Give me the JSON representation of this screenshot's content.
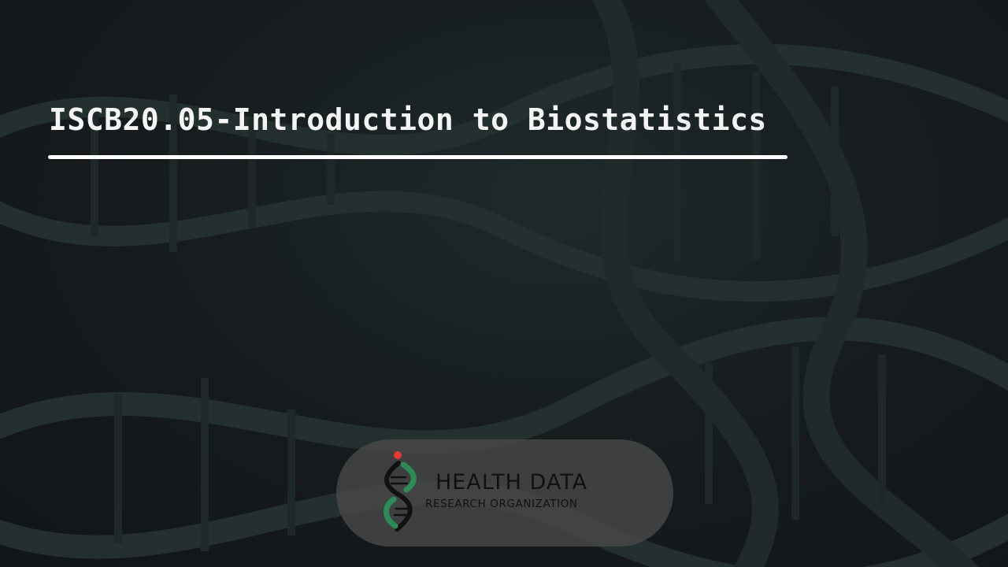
{
  "slide": {
    "title": "ISCB20.05-Introduction to Biostatistics"
  },
  "logo": {
    "line1": "HEALTH DATA",
    "line2": "RESEARCH ORGANIZATION",
    "icon": "dna-helix-icon"
  },
  "colors": {
    "title_text": "#f4f4f4",
    "underline": "#ffffff",
    "logo_dot": "#e53935",
    "logo_green": "#2e8b57",
    "logo_dark": "#111111"
  }
}
